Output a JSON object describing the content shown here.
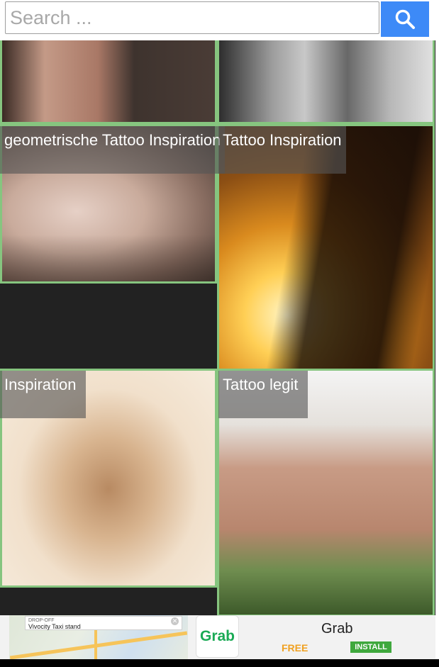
{
  "search": {
    "placeholder": "Search ..."
  },
  "tiles": [
    {
      "caption": ""
    },
    {
      "caption": ""
    },
    {
      "caption": "geometrische Tattoo Inspiration"
    },
    {
      "caption": "Tattoo Inspiration"
    },
    {
      "caption": "Inspiration"
    },
    {
      "caption": "Tattoo legit"
    }
  ],
  "ad": {
    "map_title": "DROP-OFF",
    "map_location": "Vivocity Taxi stand",
    "app_name": "Grab",
    "price": "FREE",
    "cta": "INSTALL",
    "logo_text": "Grab"
  },
  "colors": {
    "accent": "#3d8af7",
    "tile_border": "#86c57f",
    "ad_free": "#f0a020",
    "ad_install": "#3fa83d"
  }
}
